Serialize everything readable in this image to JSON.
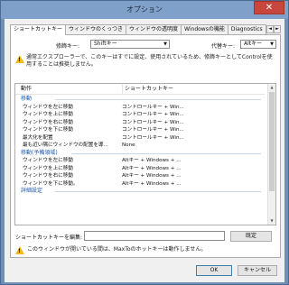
{
  "window": {
    "title": "オプション",
    "close_glyph": "✕"
  },
  "tabs": [
    {
      "label": "ショートカットキー"
    },
    {
      "label": "ウィンドウのくっつき"
    },
    {
      "label": "ウィンドウの透明度"
    },
    {
      "label": "Windowsの機能"
    },
    {
      "label": "Diagnostics"
    }
  ],
  "tab_scroll": {
    "left": "◄",
    "right": "►"
  },
  "modifier": {
    "label": "修飾キー:",
    "value": "Shiftキー"
  },
  "alternate": {
    "label": "代替キー:",
    "value": "Altキー"
  },
  "warning_top": {
    "line1": "通常エクスプローラーで、このキーはすでに設定、使用されているため、修飾キーとしてControlを使",
    "line2": "用することは推奨しません。"
  },
  "shortcut_list": {
    "header": {
      "action": "動作",
      "shortcut": "ショートカットキー"
    },
    "groups": [
      {
        "title": "移動",
        "rows": [
          {
            "action": "ウィンドウを左に移動",
            "shortcut": "コントロールキー + Win..."
          },
          {
            "action": "ウィンドウを上に移動",
            "shortcut": "コントロールキー + Win..."
          },
          {
            "action": "ウィンドウを右に移動",
            "shortcut": "コントロールキー + Win..."
          },
          {
            "action": "ウィンドウを下に移動",
            "shortcut": "コントロールキー + Win..."
          },
          {
            "action": "最大化を配置",
            "shortcut": "コントロールキー + Win..."
          },
          {
            "action": "最も近い隅にウィンドウの配置を導...",
            "shortcut": "None"
          }
        ]
      },
      {
        "title": "移動(予備領域)",
        "rows": [
          {
            "action": "ウィンドウを左に移動",
            "shortcut": "Altキー + Windows + ..."
          },
          {
            "action": "ウィンドウを上に移動",
            "shortcut": "Altキー + Windows + ..."
          },
          {
            "action": "ウィンドウを右に移動",
            "shortcut": "Altキー + Windows + ..."
          },
          {
            "action": "ウィンドウを下に移動。",
            "shortcut": "Altキー + Windows + ..."
          }
        ]
      },
      {
        "title": "詳細設定",
        "rows": []
      }
    ]
  },
  "edit": {
    "label": "ショートカットキーを編集:",
    "value": "",
    "set_button": "既定"
  },
  "warning_bottom": {
    "text": "このウィンドウが開いている間は、MaxToのホットキーは動作しません。"
  },
  "buttons": {
    "ok": "OK",
    "cancel": "キャンセル"
  },
  "colors": {
    "warning_icon": "#f3b91f",
    "group_header": "#1f5aa8",
    "close_button": "#c7463d"
  }
}
